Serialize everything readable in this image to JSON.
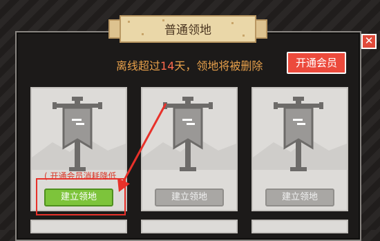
{
  "banner": {
    "title": "普通领地"
  },
  "notice": {
    "prefix": "离线超过",
    "days": "14",
    "suffix": "天，领地将被删除"
  },
  "vip_button": {
    "label": "开通会员"
  },
  "close_button": {
    "label": "✕"
  },
  "cards": [
    {
      "hint": "( 开通会员消耗降低",
      "button_label": "建立领地",
      "state": "active"
    },
    {
      "hint": "",
      "button_label": "建立领地",
      "state": "disabled"
    },
    {
      "hint": "",
      "button_label": "建立领地",
      "state": "disabled"
    }
  ],
  "colors": {
    "accent_red": "#ec4a3c",
    "active_green": "#7dc43b",
    "notice_orange": "#e7a04b",
    "highlight_red": "#e8312a"
  },
  "icons": [
    "flag-banner-icon",
    "close-icon",
    "arrow-pointer-icon"
  ]
}
